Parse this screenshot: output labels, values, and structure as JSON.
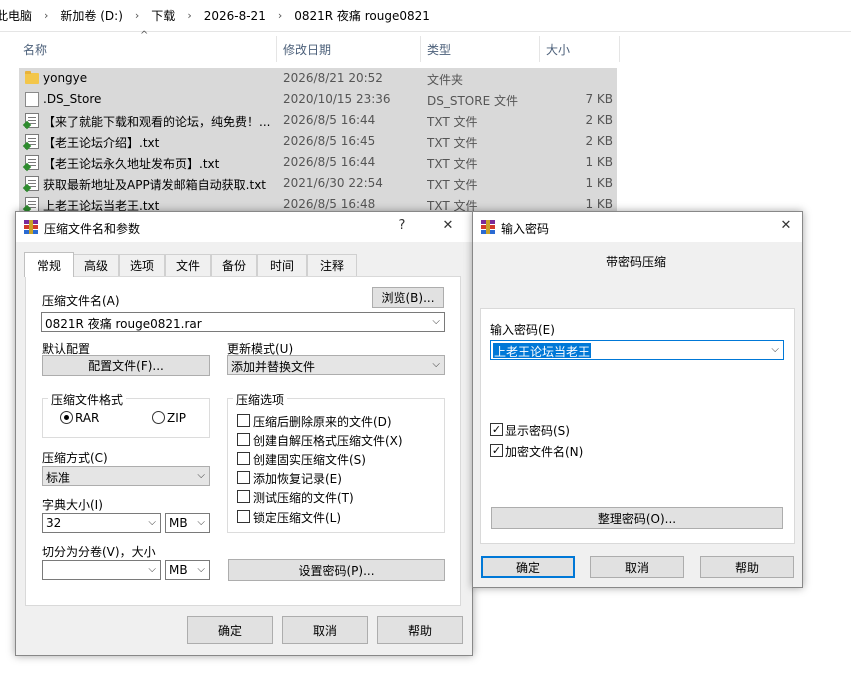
{
  "explorer": {
    "breadcrumb": [
      "此电脑",
      "新加卷 (D:)",
      "下载",
      "2026-8-21",
      "0821R 夜痛 rouge0821"
    ],
    "columns": {
      "name": "名称",
      "date": "修改日期",
      "type": "类型",
      "size": "大小"
    },
    "files": [
      {
        "icon": "folder-icon",
        "name": "yongye",
        "date": "2026/8/21 20:52",
        "type": "文件夹",
        "size": ""
      },
      {
        "icon": "file-icon",
        "name": ".DS_Store",
        "date": "2020/10/15 23:36",
        "type": "DS_STORE 文件",
        "size": "7 KB"
      },
      {
        "icon": "txt-icon",
        "name": "【来了就能下载和观看的论坛，纯免费！...",
        "date": "2026/8/5 16:44",
        "type": "TXT 文件",
        "size": "2 KB"
      },
      {
        "icon": "txt-icon",
        "name": "【老王论坛介绍】.txt",
        "date": "2026/8/5 16:45",
        "type": "TXT 文件",
        "size": "2 KB"
      },
      {
        "icon": "txt-icon",
        "name": "【老王论坛永久地址发布页】.txt",
        "date": "2026/8/5 16:44",
        "type": "TXT 文件",
        "size": "1 KB"
      },
      {
        "icon": "txt-icon",
        "name": "获取最新地址及APP请发邮箱自动获取.txt",
        "date": "2021/6/30 22:54",
        "type": "TXT 文件",
        "size": "1 KB"
      },
      {
        "icon": "txt-icon",
        "name": "上老王论坛当老王.txt",
        "date": "2026/8/5 16:48",
        "type": "TXT 文件",
        "size": "1 KB"
      }
    ]
  },
  "archive_dialog": {
    "title": "压缩文件名和参数",
    "help_glyph": "?",
    "close_glyph": "✕",
    "tabs": [
      "常规",
      "高级",
      "选项",
      "文件",
      "备份",
      "时间",
      "注释"
    ],
    "archive_name_label": "压缩文件名(A)",
    "browse_button": "浏览(B)...",
    "archive_name_value": "0821R 夜痛 rouge0821.rar",
    "default_profile_label": "默认配置",
    "profile_button": "配置文件(F)...",
    "update_mode_label": "更新模式(U)",
    "update_mode_value": "添加并替换文件",
    "format_group": "压缩文件格式",
    "format_rar": "RAR",
    "format_zip": "ZIP",
    "method_label": "压缩方式(C)",
    "method_value": "标准",
    "dict_label": "字典大小(I)",
    "dict_value": "32",
    "dict_unit": "MB",
    "split_label": "切分为分卷(V)，大小",
    "split_value": "",
    "split_unit": "MB",
    "options_group": "压缩选项",
    "options": [
      {
        "label": "压缩后删除原来的文件(D)",
        "checked": false
      },
      {
        "label": "创建自解压格式压缩文件(X)",
        "checked": false
      },
      {
        "label": "创建固实压缩文件(S)",
        "checked": false
      },
      {
        "label": "添加恢复记录(E)",
        "checked": false
      },
      {
        "label": "测试压缩的文件(T)",
        "checked": false
      },
      {
        "label": "锁定压缩文件(L)",
        "checked": false
      }
    ],
    "set_password_button": "设置密码(P)...",
    "ok_button": "确定",
    "cancel_button": "取消",
    "help_button": "帮助"
  },
  "password_dialog": {
    "title": "输入密码",
    "close_glyph": "✕",
    "heading": "带密码压缩",
    "password_label": "输入密码(E)",
    "password_value": "上老王论坛当老王",
    "show_password": "显示密码(S)",
    "encrypt_names": "加密文件名(N)",
    "organize_button": "整理密码(O)...",
    "ok_button": "确定",
    "cancel_button": "取消",
    "help_button": "帮助"
  },
  "glyphs": {
    "sep": "›",
    "dropdown": "⌵",
    "sort_up": "^",
    "check": "✓"
  }
}
